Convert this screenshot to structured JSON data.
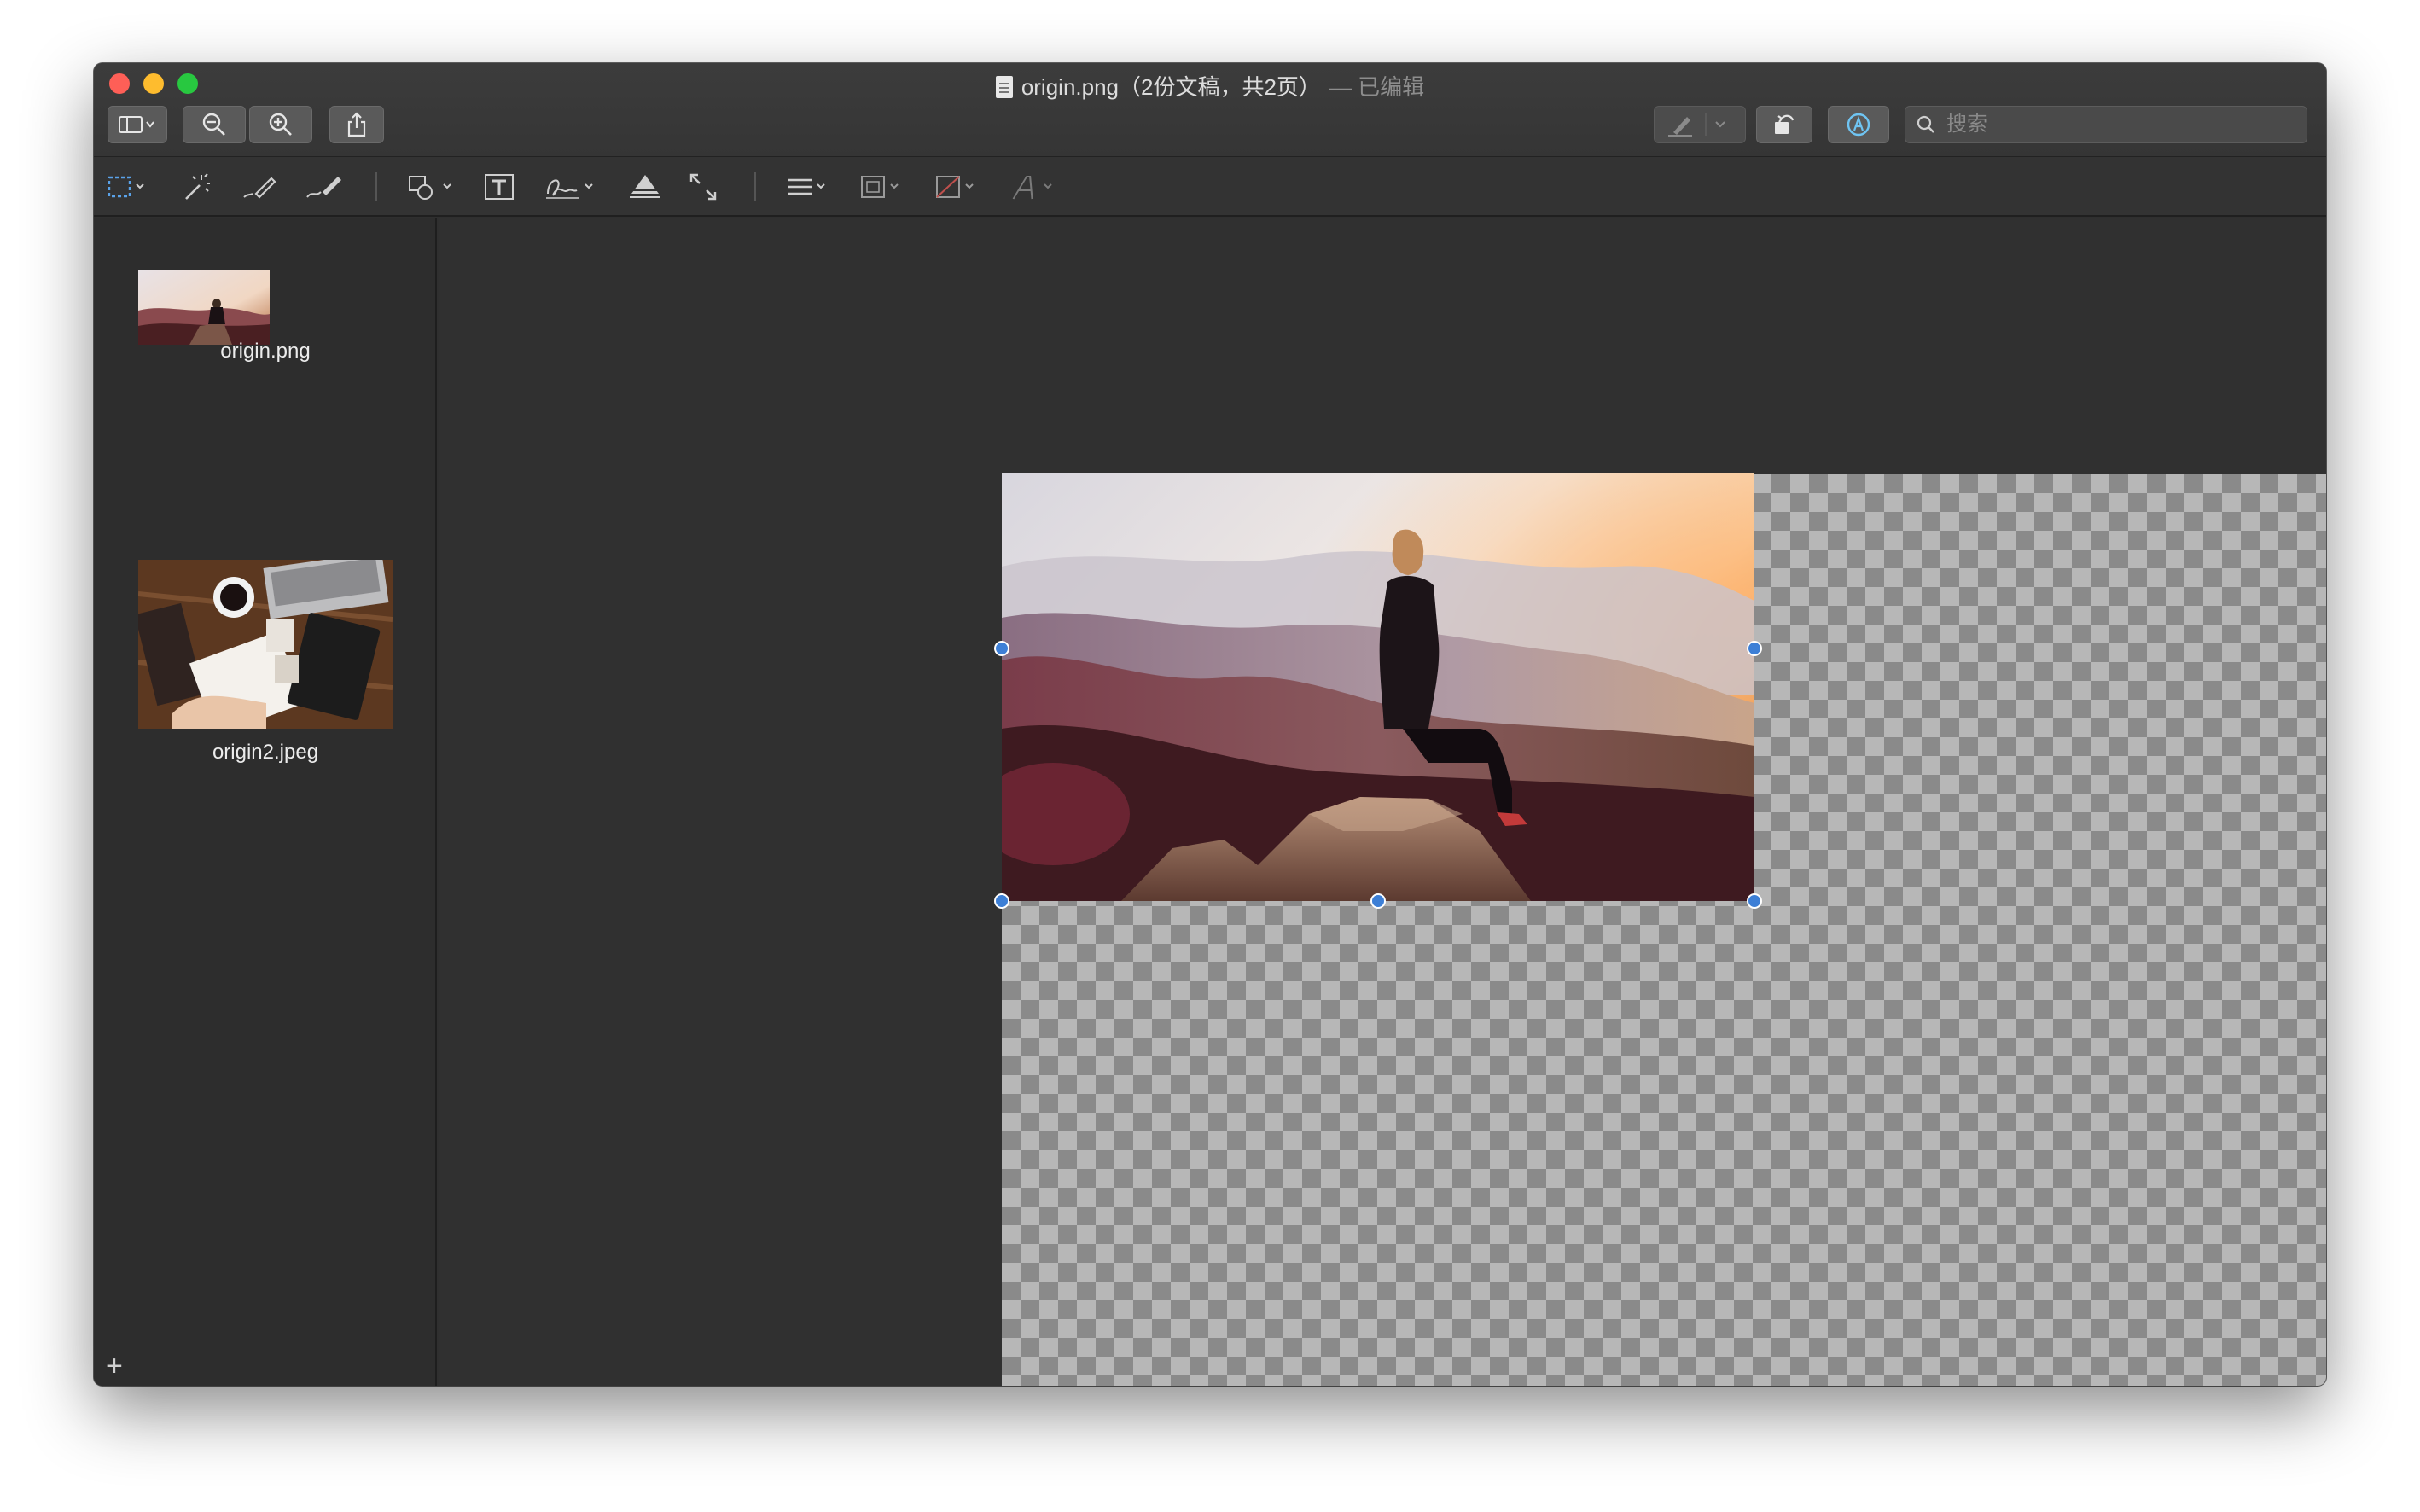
{
  "window": {
    "title": "origin.png（2份文稿，共2页）",
    "status": "— 已编辑"
  },
  "toolbar": {
    "search_placeholder": "搜索"
  },
  "icons": {
    "sidebar_toggle": "sidebar-icon",
    "zoom_out": "zoom-out-icon",
    "zoom_in": "zoom-in-icon",
    "share": "share-icon",
    "highlight": "highlighter-icon",
    "rotate": "rotate-icon",
    "markup": "markup-icon",
    "search": "search-icon"
  },
  "sidebar": {
    "items": [
      {
        "label": "origin.png"
      },
      {
        "label": "origin2.jpeg"
      }
    ],
    "add_label": "+"
  },
  "colors": {
    "window_bg": "#2f2f2f",
    "selection_handle": "#3d7fd6"
  }
}
